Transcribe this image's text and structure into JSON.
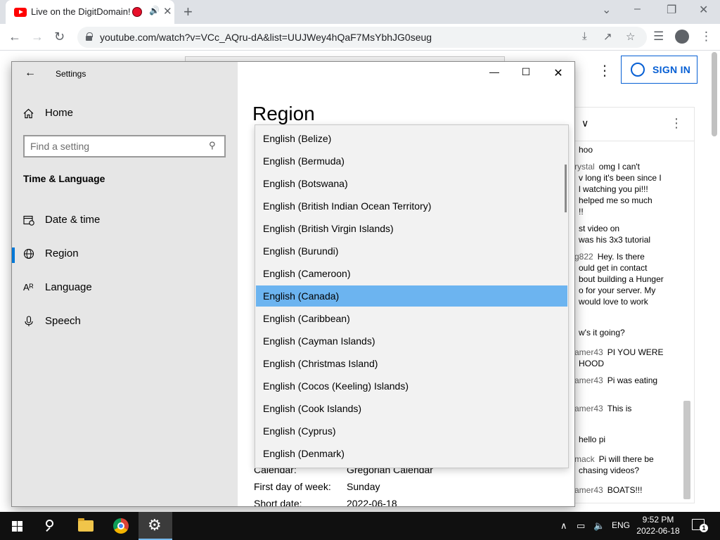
{
  "browser": {
    "tab_title": "Live on the DigitDomain!",
    "url": "youtube.com/watch?v=VCc_AQru-dA&list=UUJWey4hQaF7MsYbhJG0seug"
  },
  "youtube": {
    "signin_label": "SIGN IN",
    "chat": [
      {
        "author": "",
        "text": "hoo"
      },
      {
        "author": "rystal",
        "text": "omg I can't"
      },
      {
        "author": "",
        "text": "v long it's been since I"
      },
      {
        "author": "",
        "text": "l watching you pi!!!"
      },
      {
        "author": "",
        "text": "helped me so much"
      },
      {
        "author": "",
        "text": "!!"
      },
      {
        "author": "",
        "text": "st video on"
      },
      {
        "author": "",
        "text": "was his 3x3 tutorial"
      },
      {
        "author": "g822",
        "text": "Hey. Is there"
      },
      {
        "author": "",
        "text": "ould get in contact"
      },
      {
        "author": "",
        "text": "bout building a Hunger"
      },
      {
        "author": "",
        "text": "o for your server. My"
      },
      {
        "author": "",
        "text": "would love to work"
      },
      {
        "author": "",
        "text": "w's it going?"
      },
      {
        "author": "amer43",
        "text": "PI YOU WERE"
      },
      {
        "author": "",
        "text": "HOOD"
      },
      {
        "author": "amer43",
        "text": "Pi was eating"
      },
      {
        "author": "amer43",
        "text": "This is"
      },
      {
        "author": "",
        "text": "hello pi"
      },
      {
        "author": "mack",
        "text": "Pi will there be"
      },
      {
        "author": "",
        "text": "chasing videos?"
      },
      {
        "author": "amer43",
        "text": "BOATS!!!"
      }
    ]
  },
  "settings": {
    "window_title": "Settings",
    "home_label": "Home",
    "search_placeholder": "Find a setting",
    "section_title": "Time & Language",
    "nav": [
      {
        "label": "Date & time"
      },
      {
        "label": "Region"
      },
      {
        "label": "Language"
      },
      {
        "label": "Speech"
      }
    ],
    "selected_nav": "Region",
    "page_title": "Region",
    "regional_format_options": [
      "English (Belize)",
      "English (Bermuda)",
      "English (Botswana)",
      "English (British Indian Ocean Territory)",
      "English (British Virgin Islands)",
      "English (Burundi)",
      "English (Cameroon)",
      "English (Canada)",
      "English (Caribbean)",
      "English (Cayman Islands)",
      "English (Christmas Island)",
      "English (Cocos (Keeling) Islands)",
      "English (Cook Islands)",
      "English (Cyprus)",
      "English (Denmark)"
    ],
    "selected_format": "English (Canada)",
    "format_rows": [
      {
        "label": "Calendar:",
        "value": "Gregorian Calendar"
      },
      {
        "label": "First day of week:",
        "value": "Sunday"
      },
      {
        "label": "Short date:",
        "value": "2022-06-18"
      }
    ]
  },
  "taskbar": {
    "language": "ENG",
    "time": "9:52 PM",
    "date": "2022-06-18",
    "notification_count": "1"
  },
  "colors": {
    "accent": "#0078d7",
    "selection": "#6cb4f0",
    "youtube_blue": "#065fd4"
  }
}
